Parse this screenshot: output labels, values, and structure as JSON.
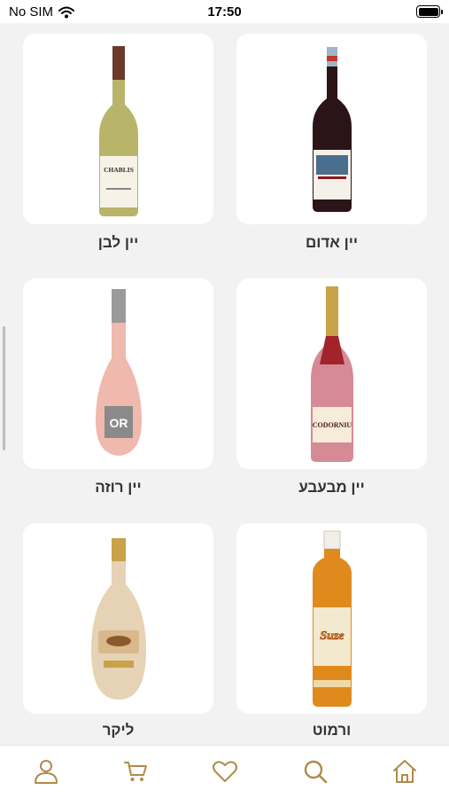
{
  "status_bar": {
    "carrier": "No SIM",
    "time": "17:50"
  },
  "products": [
    {
      "label": "יין אדום",
      "icon": "red-wine-bottle"
    },
    {
      "label": "יין לבן",
      "icon": "white-wine-bottle",
      "bottle_text": "CHABLIS"
    },
    {
      "label": "יין מבעבע",
      "icon": "sparkling-wine-bottle",
      "bottle_text": "CODORNIU"
    },
    {
      "label": "יין רוזה",
      "icon": "rose-wine-bottle",
      "bottle_text": "OR"
    },
    {
      "label": "ורמוט",
      "icon": "vermouth-bottle",
      "bottle_text": "Suze"
    },
    {
      "label": "ליקר",
      "icon": "liqueur-bottle"
    }
  ],
  "bottom_nav": [
    {
      "name": "home",
      "icon": "home-icon"
    },
    {
      "name": "search",
      "icon": "search-icon"
    },
    {
      "name": "favorites",
      "icon": "heart-icon"
    },
    {
      "name": "cart",
      "icon": "cart-icon"
    },
    {
      "name": "profile",
      "icon": "user-icon"
    }
  ],
  "colors": {
    "accent": "#b08a4a",
    "background": "#f2f2f2",
    "card": "#ffffff"
  }
}
